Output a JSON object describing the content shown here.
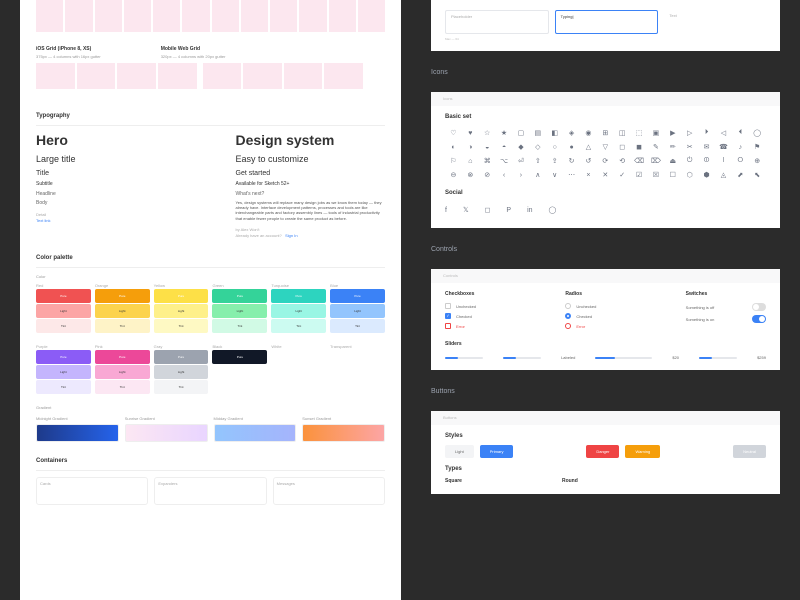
{
  "left": {
    "grid1_label": "iOS Grid (iPhone 8, XS)",
    "grid1_sub": "375px — 4 columns with 16px gutter",
    "grid2_label": "Mobile Web Grid",
    "grid2_sub": "320px — 4 columns with 20px gutter",
    "typography_h": "Typography",
    "hero1": "Hero",
    "hero2": "Design system",
    "lg1": "Large title",
    "lg2": "Easy to customize",
    "title1": "Title",
    "title2": "Get started",
    "sub1": "Subtitle",
    "sub2": "Available for Sketch 52+",
    "hd1": "Headline",
    "hd2": "What's next?",
    "bd1": "Body",
    "para": "Yes, design systems will replace many design jobs as we know them today — they already have. Interface development patterns, processes and tools are like interchangeable parts and factory assembly lines — tools of industrial productivity that enable fewer people to create the same product as before.",
    "detail1": "Detail",
    "detail2": "by Alex Won't",
    "link1": "Text link",
    "account": "Already have an account?",
    "signin": "Sign In",
    "palette_h": "Color palette",
    "color_label": "Color",
    "gradient_label": "Gradient",
    "colors_row1": [
      {
        "name": "Red",
        "pure": "#f05252",
        "light": "#fca5a5",
        "tint": "#fde8e8"
      },
      {
        "name": "Orange",
        "pure": "#f59e0b",
        "light": "#fcd34d",
        "tint": "#fef3c7"
      },
      {
        "name": "Yellow",
        "pure": "#fde047",
        "light": "#fef08a",
        "tint": "#fef9c3"
      },
      {
        "name": "Green",
        "pure": "#34d399",
        "light": "#86efac",
        "tint": "#d1fae5"
      },
      {
        "name": "Turquoise",
        "pure": "#2dd4bf",
        "light": "#99f6e4",
        "tint": "#ccfbf1"
      },
      {
        "name": "Blue",
        "pure": "#3b82f6",
        "light": "#93c5fd",
        "tint": "#dbeafe"
      }
    ],
    "colors_row2": [
      {
        "name": "Purple",
        "pure": "#8b5cf6",
        "light": "#c4b5fd",
        "tint": "#ede9fe"
      },
      {
        "name": "Pink",
        "pure": "#ec4899",
        "light": "#f9a8d4",
        "tint": "#fce7f3"
      },
      {
        "name": "Gray",
        "pure": "#9ca3af",
        "light": "#d1d5db",
        "tint": "#f3f4f6"
      },
      {
        "name": "Black",
        "pure": "#111827",
        "light": "",
        "tint": ""
      },
      {
        "name": "White",
        "pure": "",
        "light": "",
        "tint": ""
      },
      {
        "name": "Transparent",
        "pure": "",
        "light": "",
        "tint": ""
      }
    ],
    "gradients": [
      {
        "name": "Midnight Gradient",
        "css": "linear-gradient(90deg,#1e3a8a,#2563eb)"
      },
      {
        "name": "Sunrise Gradient",
        "css": "linear-gradient(90deg,#fce7f3,#e9d5ff)"
      },
      {
        "name": "Midday Gradient",
        "css": "linear-gradient(90deg,#93c5fd,#a5b4fc)"
      },
      {
        "name": "Sunset Gradient",
        "css": "linear-gradient(90deg,#fb923c,#fca5a5)"
      }
    ],
    "containers_h": "Containers",
    "containers": [
      "Cards",
      "Expanders",
      "Messages"
    ],
    "pure": "Pure",
    "light": "Light",
    "tint": "Tint"
  },
  "right": {
    "inputs": {
      "ph": "Placeholder",
      "typing": "Typing|",
      "text": "Text",
      "max": "Max — 64"
    },
    "icons_h": "Icons",
    "icons_hdr": "Icons",
    "basic_h": "Basic set",
    "social_h": "Social",
    "controls_h": "Controls",
    "controls_hdr": "Controls",
    "cb_h": "Checkboxes",
    "rd_h": "Radios",
    "sw_h": "Switches",
    "unchecked": "Unchecked",
    "checked": "Checked",
    "error": "Error",
    "off": "Something is off",
    "on": "Something is on",
    "sliders_h": "Sliders",
    "labeled": "Labeled",
    "v1": "$20",
    "v2": "$259",
    "buttons_h": "Buttons",
    "buttons_hdr": "Buttons",
    "styles_h": "Styles",
    "btns": {
      "light": "Light",
      "primary": "Primary",
      "danger": "Danger",
      "warning": "Warning",
      "neutral": "Neutral"
    },
    "types_h": "Types",
    "square": "Square",
    "round": "Round"
  }
}
